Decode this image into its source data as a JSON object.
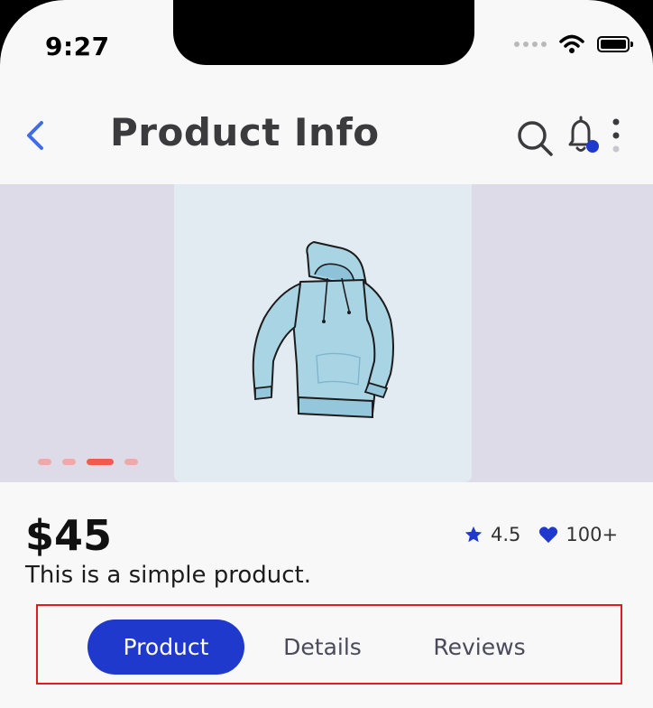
{
  "status_bar": {
    "time": "9:27"
  },
  "header": {
    "title": "Product Info",
    "icons": [
      "back-chevron-icon",
      "search-icon",
      "bell-icon",
      "more-vertical-icon"
    ],
    "notification_dot_color": "#1f39cc"
  },
  "carousel": {
    "page_count": 4,
    "active_page": 3,
    "image": "hoodie-illustration"
  },
  "product": {
    "price": "$45",
    "description": "This is a simple product.",
    "rating": "4.5",
    "likes": "100+"
  },
  "tabs": [
    {
      "label": "Product",
      "active": true
    },
    {
      "label": "Details",
      "active": false
    },
    {
      "label": "Reviews",
      "active": false
    }
  ],
  "colors": {
    "accent": "#1f39cc",
    "pager_active": "#f05a50",
    "pager_inactive": "#eeaaa8",
    "carousel_bg": "#dedbe8",
    "highlight_frame": "#e01b24"
  }
}
